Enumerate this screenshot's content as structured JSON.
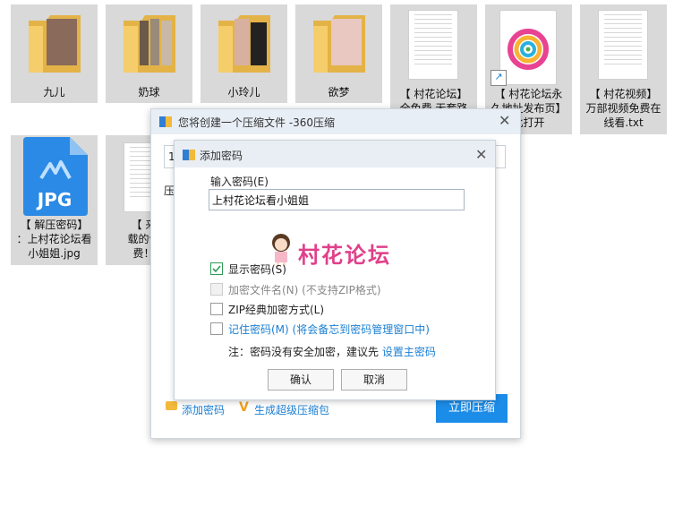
{
  "desktop_items": [
    {
      "label": "九儿",
      "kind": "folder"
    },
    {
      "label": "奶球",
      "kind": "folder"
    },
    {
      "label": "小玲儿",
      "kind": "folder"
    },
    {
      "label": "欲梦",
      "kind": "folder"
    },
    {
      "label_lines": [
        "【 村花论坛】",
        "全免费 无套路"
      ],
      "kind": "doc"
    },
    {
      "label_lines": [
        "【 村花论坛永",
        "久地址发布页】",
        "此打开"
      ],
      "kind": "shortcut"
    },
    {
      "label_lines": [
        "【 村花视频】",
        "万部视频免费在",
        "线看.txt"
      ],
      "kind": "doc"
    },
    {
      "label_lines": [
        "【 解压密码】",
        "：上村花论坛看",
        "小姐姐.jpg"
      ],
      "kind": "jpg",
      "badge": "JPG"
    },
    {
      "label_lines": [
        "【 来了",
        "载的论坛",
        "费！】"
      ],
      "kind": "doc"
    }
  ],
  "compress_dialog": {
    "title": "您将创建一个压缩文件 -360压缩",
    "field_fragment": "1",
    "label_fragment": "压",
    "add_password": "添加密码",
    "super_pack": "生成超级压缩包",
    "start_button": "立即压缩"
  },
  "password_dialog": {
    "title": "添加密码",
    "input_label": "输入密码(E)",
    "password_value": "上村花论坛看小姐姐",
    "watermark": "村花论坛",
    "options": [
      {
        "label": "显示密码(S)",
        "checked": true,
        "enabled": true
      },
      {
        "label": "加密文件名(N) (不支持ZIP格式)",
        "checked": false,
        "enabled": false
      },
      {
        "label": "ZIP经典加密方式(L)",
        "checked": false,
        "enabled": true
      },
      {
        "label": "记住密码(M) (将会备忘到密码管理窗口中)",
        "checked": false,
        "enabled": true
      }
    ],
    "note_prefix": "注：密码没有安全加密，建议先 ",
    "note_link": "设置主密码",
    "ok_button": "确认",
    "cancel_button": "取消"
  },
  "colors": {
    "accent": "#1b8ce8",
    "link": "#1b7fd2",
    "watermark": "#e0408a",
    "check": "#2e9b55"
  }
}
